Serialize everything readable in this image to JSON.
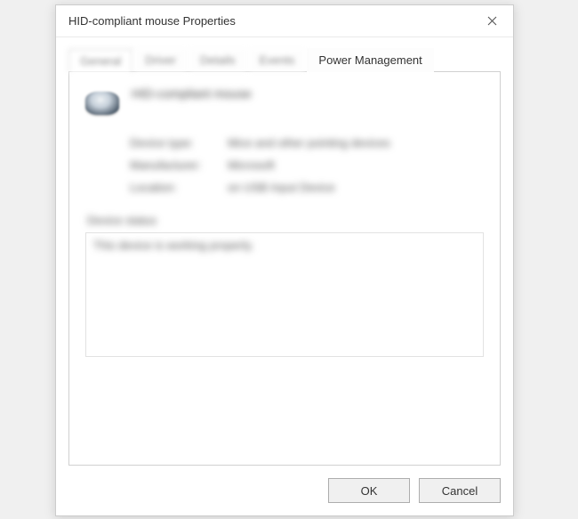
{
  "title": "HID-compliant mouse Properties",
  "tabs": {
    "general": "General",
    "driver": "Driver",
    "details": "Details",
    "events": "Events",
    "power": "Power Management"
  },
  "device": {
    "name": "HID-compliant mouse",
    "props": {
      "type_label": "Device type:",
      "type_value": "Mice and other pointing devices",
      "mfr_label": "Manufacturer:",
      "mfr_value": "Microsoft",
      "loc_label": "Location:",
      "loc_value": "on USB Input Device"
    },
    "status_label": "Device status",
    "status_text": "This device is working properly."
  },
  "buttons": {
    "ok": "OK",
    "cancel": "Cancel"
  }
}
